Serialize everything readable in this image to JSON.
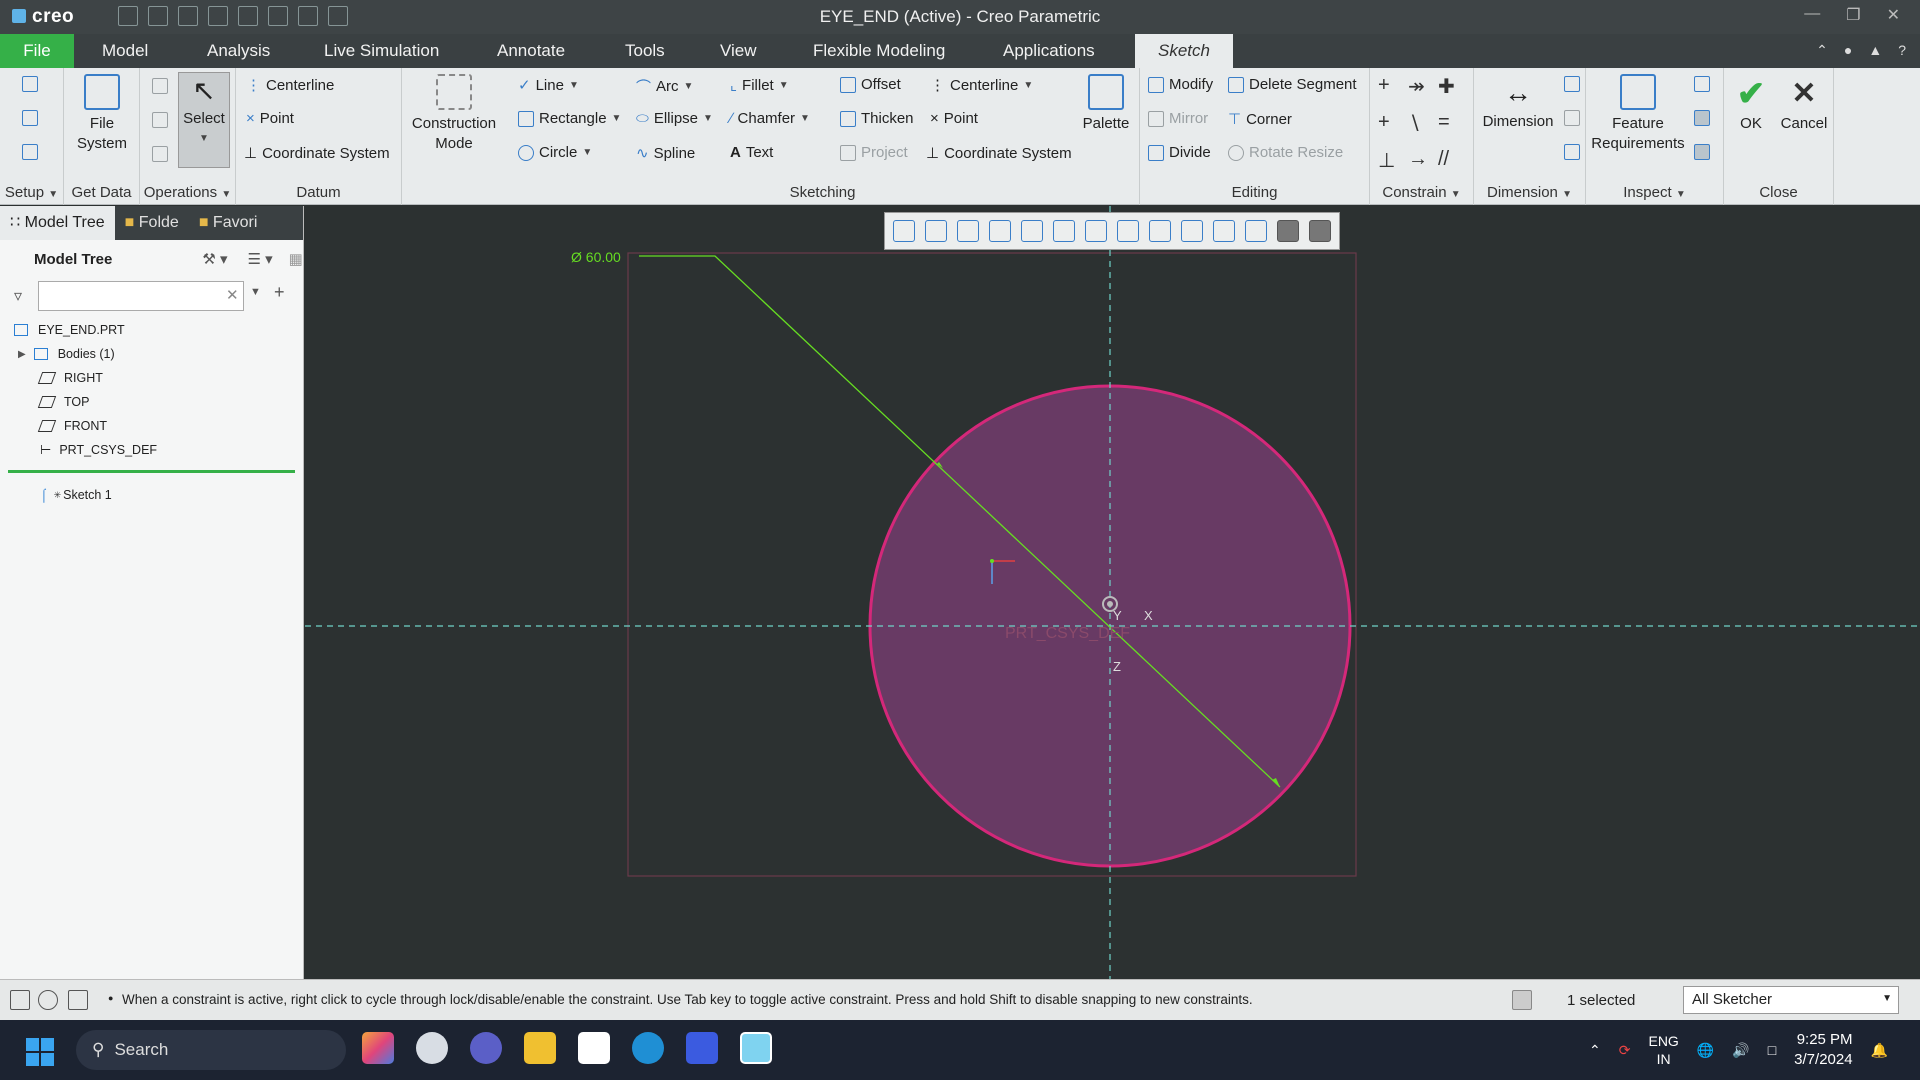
{
  "window": {
    "app_logo": "creo",
    "title": "EYE_END (Active) - Creo Parametric"
  },
  "tabs": [
    "File",
    "Model",
    "Analysis",
    "Live Simulation",
    "Annotate",
    "Tools",
    "View",
    "Flexible Modeling",
    "Applications",
    "Sketch"
  ],
  "active_tab": "Sketch",
  "ribbon": {
    "setup": {
      "label": "Setup"
    },
    "get_data": {
      "label": "Get Data",
      "file_system": "File\nSystem"
    },
    "operations": {
      "label": "Operations",
      "select": "Select"
    },
    "datum": {
      "label": "Datum",
      "centerline": "Centerline",
      "point": "Point",
      "csys": "Coordinate System"
    },
    "construction_mode": "Construction\nMode",
    "sketching": {
      "label": "Sketching",
      "line": "Line",
      "rectangle": "Rectangle",
      "circle": "Circle",
      "arc": "Arc",
      "ellipse": "Ellipse",
      "spline": "Spline",
      "fillet": "Fillet",
      "chamfer": "Chamfer",
      "text": "Text",
      "offset": "Offset",
      "thicken": "Thicken",
      "project": "Project",
      "centerline": "Centerline",
      "point": "Point",
      "csys": "Coordinate System",
      "palette": "Palette"
    },
    "editing": {
      "label": "Editing",
      "modify": "Modify",
      "mirror": "Mirror",
      "divide": "Divide",
      "delete_segment": "Delete Segment",
      "corner": "Corner",
      "rotate_resize": "Rotate Resize"
    },
    "constrain": {
      "label": "Constrain"
    },
    "dimension": {
      "label": "Dimension",
      "button": "Dimension"
    },
    "inspect": {
      "label": "Inspect",
      "feature_req": "Feature\nRequirements"
    },
    "close": {
      "label": "Close",
      "ok": "OK",
      "cancel": "Cancel"
    }
  },
  "left_panel": {
    "tabs": [
      "Model Tree",
      "Folde",
      "Favori"
    ],
    "header": "Model Tree",
    "search_placeholder": "",
    "tree": [
      {
        "label": "EYE_END.PRT",
        "icon": "part-icon"
      },
      {
        "label": "Bodies (1)",
        "icon": "bodies-icon"
      },
      {
        "label": "RIGHT",
        "icon": "datum-plane-icon"
      },
      {
        "label": "TOP",
        "icon": "datum-plane-icon"
      },
      {
        "label": "FRONT",
        "icon": "datum-plane-icon"
      },
      {
        "label": "PRT_CSYS_DEF",
        "icon": "csys-icon"
      }
    ],
    "sketch_item": "Sketch 1"
  },
  "canvas": {
    "dimension_text": "Ø 60.00",
    "csys_label": "PRT_CSYS_DEF",
    "axis_x": "X",
    "axis_y": "Y",
    "axis_z": "Z",
    "circle_color": "#d4287a",
    "circle_fill": "#6a3a64",
    "dimension_color": "#66dd22",
    "centerline_color": "#6fd3c8"
  },
  "status": {
    "message": "When a constraint is active, right click to cycle through lock/disable/enable the constraint. Use Tab key to toggle active constraint. Press and hold Shift to disable snapping to new constraints.",
    "selected": "1 selected",
    "filter": "All Sketcher"
  },
  "taskbar": {
    "search": "Search",
    "lang_top": "ENG",
    "lang_bottom": "IN",
    "time": "9:25 PM",
    "date": "3/7/2024"
  }
}
